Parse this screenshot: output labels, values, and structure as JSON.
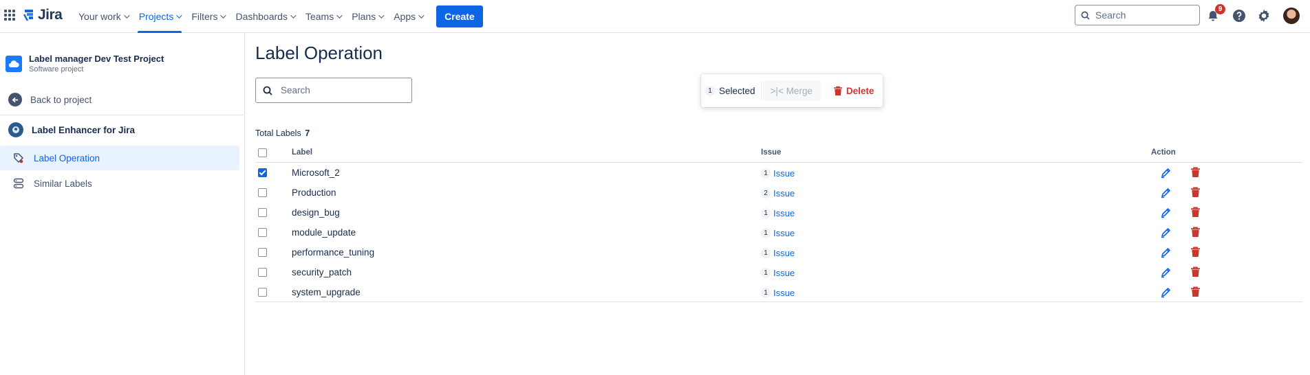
{
  "topnav": {
    "logo_text": "Jira",
    "items": [
      {
        "label": "Your work",
        "active": false
      },
      {
        "label": "Projects",
        "active": true
      },
      {
        "label": "Filters",
        "active": false
      },
      {
        "label": "Dashboards",
        "active": false
      },
      {
        "label": "Teams",
        "active": false
      },
      {
        "label": "Plans",
        "active": false
      },
      {
        "label": "Apps",
        "active": false
      }
    ],
    "create_label": "Create",
    "search_placeholder": "Search",
    "notification_count": "9",
    "icons": [
      "app-switcher-icon",
      "notification-icon",
      "help-icon",
      "settings-icon",
      "avatar"
    ]
  },
  "sidebar": {
    "project_name": "Label manager Dev Test Project",
    "project_type": "Software project",
    "back_label": "Back to project",
    "app_name": "Label Enhancer for Jira",
    "items": [
      {
        "label": "Label Operation",
        "active": true,
        "icon": "label-tag-icon"
      },
      {
        "label": "Similar Labels",
        "active": false,
        "icon": "stack-icon"
      }
    ]
  },
  "main": {
    "title": "Label Operation",
    "search_placeholder": "Search",
    "selection_bar": {
      "count": "1",
      "selected_label": "Selected",
      "merge_label": ">|< Merge",
      "delete_label": "Delete"
    },
    "total_label": "Total Labels",
    "total_count": "7",
    "columns": {
      "label": "Label",
      "issue": "Issue",
      "action": "Action"
    },
    "rows": [
      {
        "label": "Microsoft_2",
        "issue_count": "1",
        "issue_text": "Issue",
        "checked": true
      },
      {
        "label": "Production",
        "issue_count": "2",
        "issue_text": "Issue",
        "checked": false
      },
      {
        "label": "design_bug",
        "issue_count": "1",
        "issue_text": "Issue",
        "checked": false
      },
      {
        "label": "module_update",
        "issue_count": "1",
        "issue_text": "Issue",
        "checked": false
      },
      {
        "label": "performance_tuning",
        "issue_count": "1",
        "issue_text": "Issue",
        "checked": false
      },
      {
        "label": "security_patch",
        "issue_count": "1",
        "issue_text": "Issue",
        "checked": false
      },
      {
        "label": "system_upgrade",
        "issue_count": "1",
        "issue_text": "Issue",
        "checked": false
      }
    ]
  },
  "colors": {
    "brand_blue": "#0c66e4",
    "danger_red": "#c9372c",
    "text": "#172b4d"
  }
}
